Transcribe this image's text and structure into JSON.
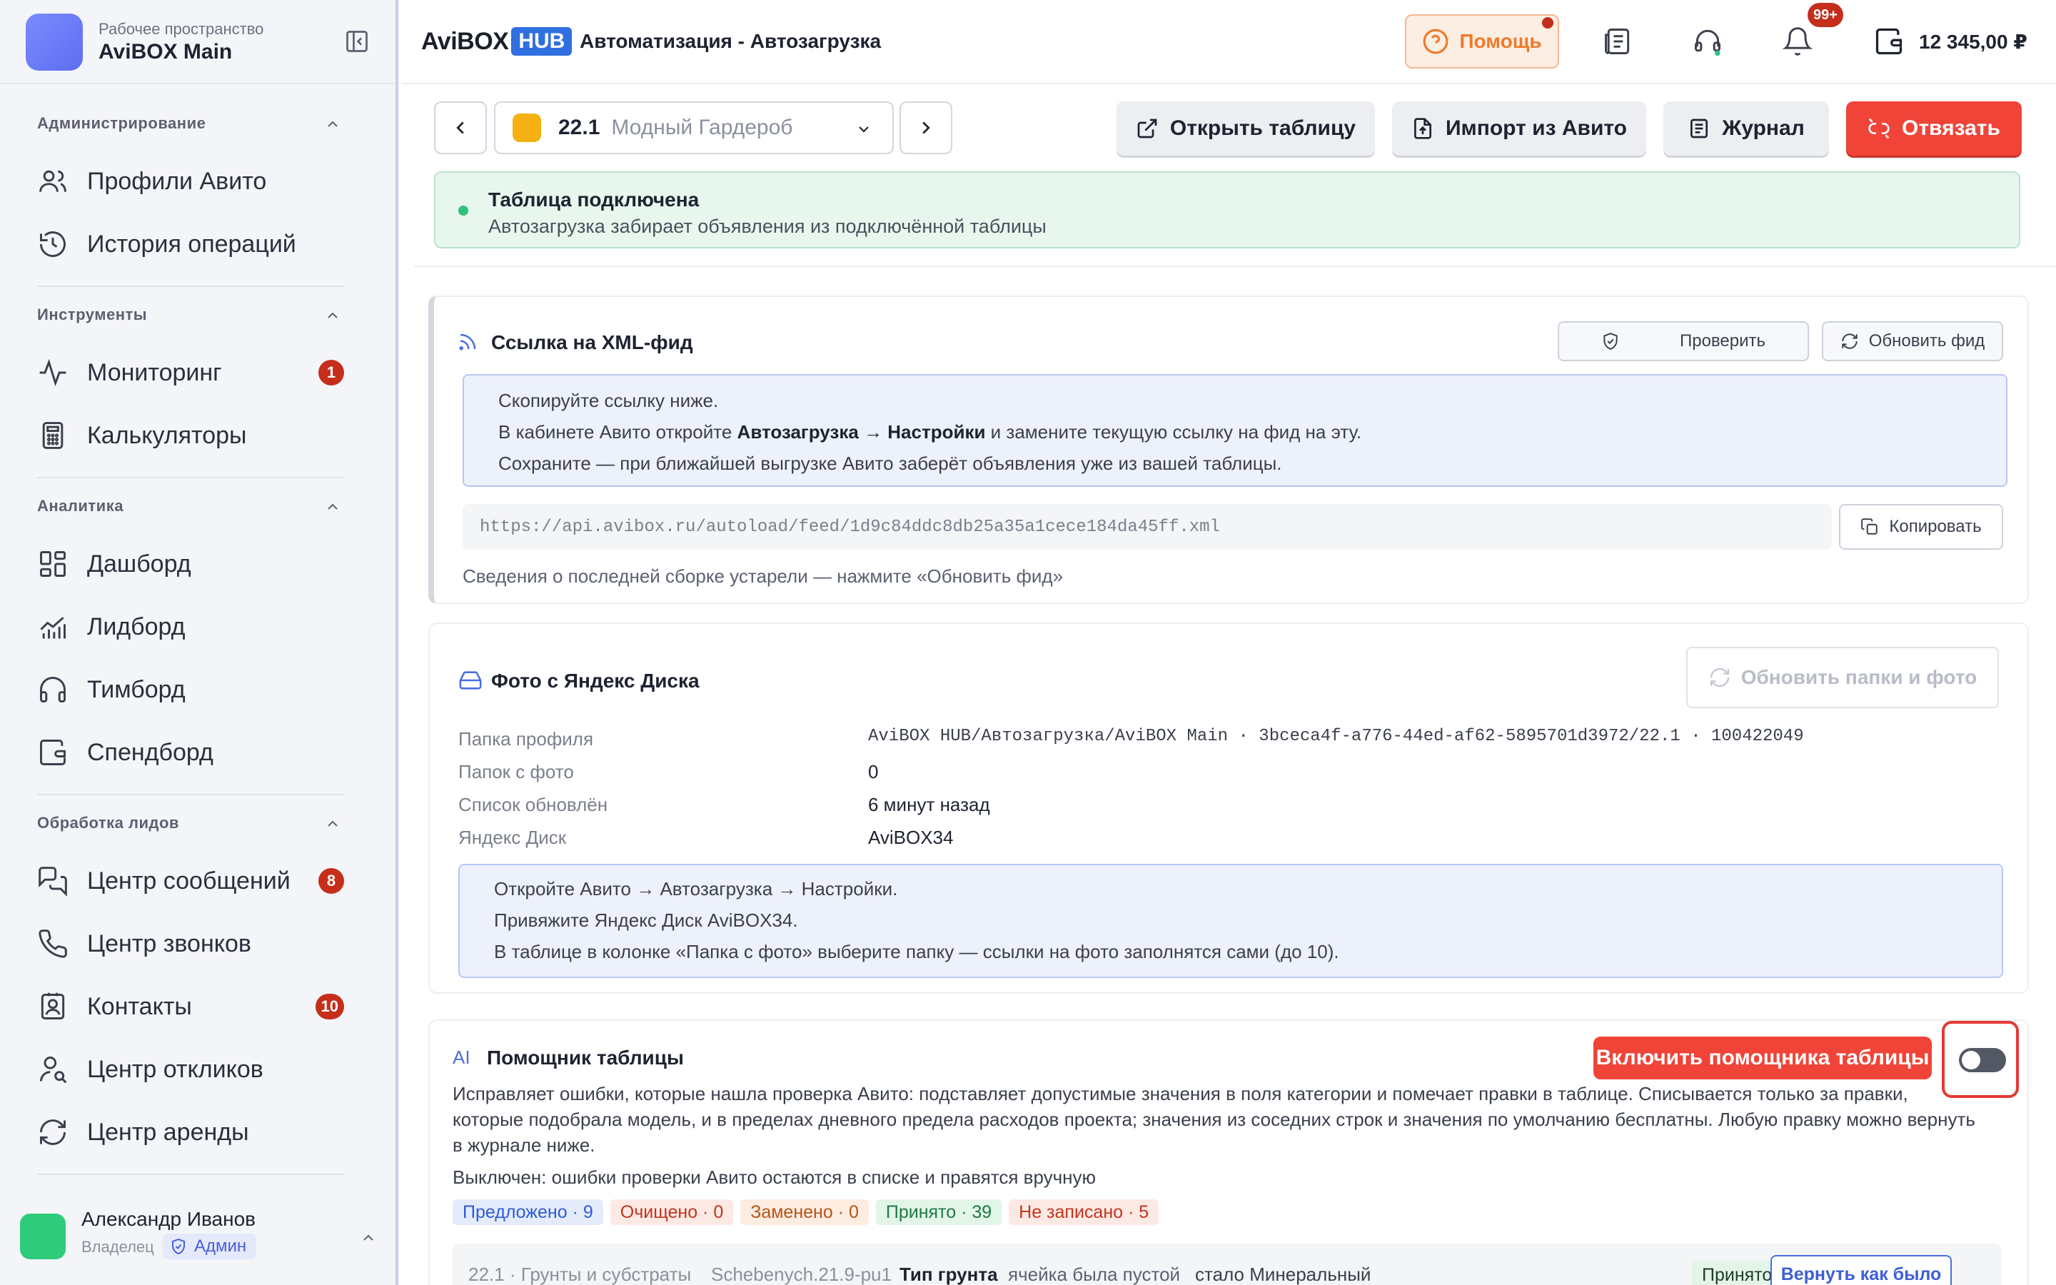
{
  "workspace": {
    "subtitle": "Рабочее пространство",
    "name": "AviBOX Main"
  },
  "sidebar": {
    "sections": [
      {
        "title": "Администрирование",
        "items": [
          {
            "label": "Профили Авито",
            "icon": "users-icon"
          },
          {
            "label": "История операций",
            "icon": "history-icon"
          }
        ]
      },
      {
        "title": "Инструменты",
        "items": [
          {
            "label": "Мониторинг",
            "icon": "activity-icon",
            "badge": "1"
          },
          {
            "label": "Калькуляторы",
            "icon": "calculator-icon"
          }
        ]
      },
      {
        "title": "Аналитика",
        "items": [
          {
            "label": "Дашборд",
            "icon": "dashboard-icon"
          },
          {
            "label": "Лидборд",
            "icon": "chart-icon"
          },
          {
            "label": "Тимборд",
            "icon": "headphones-icon"
          },
          {
            "label": "Спендборд",
            "icon": "wallet-icon"
          }
        ]
      },
      {
        "title": "Обработка лидов",
        "items": [
          {
            "label": "Центр сообщений",
            "icon": "messages-icon",
            "badge": "8"
          },
          {
            "label": "Центр звонков",
            "icon": "phone-icon"
          },
          {
            "label": "Контакты",
            "icon": "contacts-icon",
            "badge": "10"
          },
          {
            "label": "Центр откликов",
            "icon": "user-search-icon"
          },
          {
            "label": "Центр аренды",
            "icon": "refresh-icon"
          }
        ]
      }
    ]
  },
  "user": {
    "name": "Александр Иванов",
    "role": "Владелец",
    "badge": "Админ"
  },
  "topbar": {
    "brand_main": "AviBOX",
    "brand_hub": "HUB",
    "breadcrumb": "Автоматизация - Автозагрузка",
    "help_label": "Помощь",
    "notifications_badge": "99+",
    "balance": "12 345,00 ₽"
  },
  "toolbar": {
    "profile_number": "22.1",
    "profile_name": "Модный Гардероб",
    "open_table": "Открыть таблицу",
    "import_avito": "Импорт из Авито",
    "journal": "Журнал",
    "unlink": "Отвязать"
  },
  "status": {
    "title": "Таблица подключена",
    "subtitle": "Автозагрузка забирает объявления из подключённой таблицы"
  },
  "xml_feed": {
    "title": "Ссылка на XML-фид",
    "check_btn": "Проверить",
    "refresh_btn": "Обновить фид",
    "line1": "Скопируйте ссылку ниже.",
    "line2_pre": "В кабинете Авито откройте ",
    "line2_bold": "Автозагрузка → Настройки",
    "line2_post": " и замените текущую ссылку на фид на эту.",
    "line3": "Сохраните — при ближайшей выгрузке Авито заберёт объявления уже из вашей таблицы.",
    "url": "https://api.avibox.ru/autoload/feed/1d9c84ddc8db25a35a1cece184da45ff.xml",
    "copy_btn": "Копировать",
    "hint": "Сведения о последней сборке устарели — нажмите «Обновить фид»"
  },
  "yadisk": {
    "title": "Фото с Яндекс Диска",
    "refresh_btn": "Обновить папки и фото",
    "rows": [
      {
        "key": "Папка профиля",
        "value": "AviBOX HUB/Автозагрузка/AviBOX Main · 3bceca4f-a776-44ed-af62-5895701d3972/22.1 · 100422049"
      },
      {
        "key": "Папок с фото",
        "value": "0"
      },
      {
        "key": "Список обновлён",
        "value": "6 минут назад"
      },
      {
        "key": "Яндекс Диск",
        "value": "AviBOX34"
      }
    ],
    "info1": "Откройте Авито → Автозагрузка → Настройки.",
    "info2": "Привяжите Яндекс Диск AviBOX34.",
    "info3": "В таблице в колонке «Папка с фото» выберите папку — ссылки на фото заполнятся сами (до 10)."
  },
  "assistant": {
    "tag": "AI",
    "title": "Помощник таблицы",
    "enable_btn": "Включить помощника таблицы",
    "toggle_on": false,
    "description": "Исправляет ошибки, которые нашла проверка Авито: подставляет допустимые значения в поля категории и помечает правки в таблице. Списывается только за правки, которые подобрала модель, и в пределах дневного предела расходов проекта; значения из соседних строк и значения по умолчанию бесплатны. Любую правку можно вернуть в журнале ниже.",
    "off_text": "Выключен: ошибки проверки Авито остаются в списке и правятся вручную",
    "chips": [
      {
        "label": "Предложено · 9",
        "tone": "blue"
      },
      {
        "label": "Очищено · 0",
        "tone": "red"
      },
      {
        "label": "Заменено · 0",
        "tone": "orange"
      },
      {
        "label": "Принято · 39",
        "tone": "green"
      },
      {
        "label": "Не записано · 5",
        "tone": "red"
      }
    ],
    "edit_row": {
      "category": "22.1 · Грунты и субстраты",
      "sku": "Schebenych.21.9-pu1",
      "field": "Тип грунта",
      "before": "ячейка была пустой",
      "after": "стало Минеральный",
      "status": "Принято",
      "revert": "Вернуть как было"
    }
  }
}
